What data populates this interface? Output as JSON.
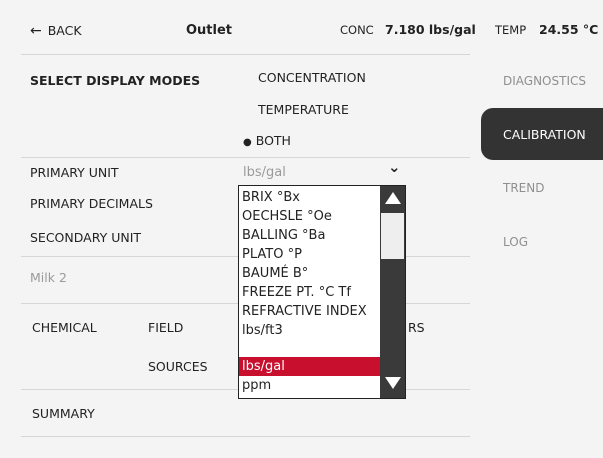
{
  "header": {
    "back_label": "BACK",
    "back_arrow": "←",
    "title": "Outlet",
    "conc_label": "CONC",
    "conc_value": "7.180 lbs/gal",
    "temp_label": "TEMP",
    "temp_value": "24.55 °C"
  },
  "display_modes": {
    "label": "SELECT DISPLAY MODES",
    "options": [
      "CONCENTRATION",
      "TEMPERATURE",
      "BOTH"
    ],
    "selected": "BOTH",
    "bullet": "●"
  },
  "settings": {
    "primary_unit_label": "PRIMARY UNIT",
    "primary_unit_value": "lbs/gal",
    "chevron": "⌄",
    "primary_decimals_label": "PRIMARY DECIMALS",
    "secondary_unit_label": "SECONDARY UNIT"
  },
  "product_name": "Milk 2",
  "buttons": {
    "chemical": "CHEMICAL",
    "field": "FIELD",
    "rs_fragment": "RS",
    "sources": "SOURCES",
    "summary": "SUMMARY"
  },
  "sidebar": {
    "items": [
      "DIAGNOSTICS",
      "CALIBRATION",
      "TREND",
      "LOG"
    ],
    "active": "CALIBRATION"
  },
  "dropdown": {
    "options": [
      "BRIX °Bx",
      "OECHSLE °Oe",
      "BALLING °Ba",
      "PLATO °P",
      "BAUMÉ B°",
      "FREEZE PT. °C Tf",
      "REFRACTIVE INDEX",
      "lbs/ft3",
      "lbs/gal",
      "ppm"
    ],
    "selected": "lbs/gal"
  },
  "colors": {
    "accent": "#c8102e",
    "sidebar_active_bg": "#333333",
    "background": "#f4f4f4"
  }
}
